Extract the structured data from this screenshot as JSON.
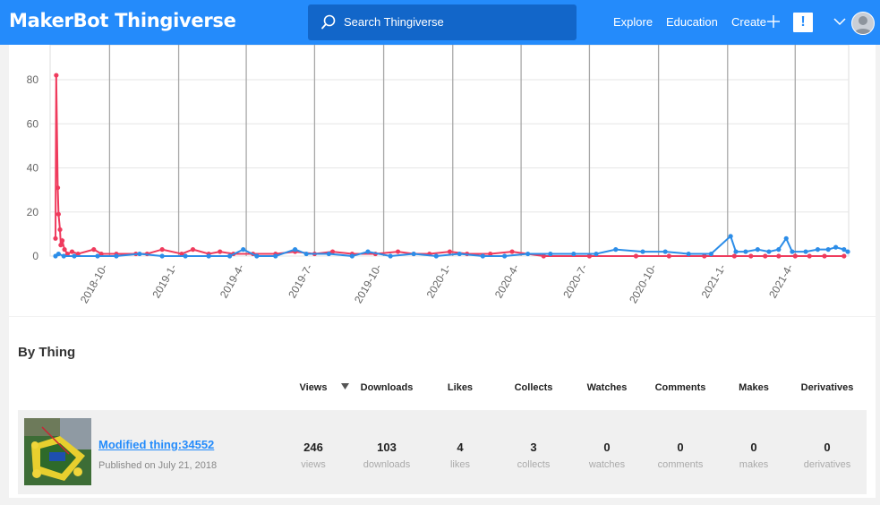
{
  "header": {
    "logo_brand": "MakerBot",
    "logo_product": "Thingiverse",
    "search_placeholder": "Search Thingiverse",
    "nav": {
      "explore": "Explore",
      "education": "Education",
      "create": "Create"
    },
    "alert_label": "!",
    "colors": {
      "bar": "#248bfb",
      "search": "#1266c9"
    }
  },
  "chart_data": {
    "type": "line",
    "y_ticks": [
      "0",
      "20",
      "40",
      "60",
      "80"
    ],
    "ylim": [
      0,
      90
    ],
    "x_ticks": [
      "2018-10-",
      "2019-1-",
      "2019-4-",
      "2019-7-",
      "2019-10-",
      "2020-1-",
      "2020-4-",
      "2020-7-",
      "2020-10-",
      "2021-1-",
      "2021-4-"
    ],
    "grid": true,
    "x_range": [
      "2018-07-21",
      "2021-06-10"
    ],
    "series": [
      {
        "color": "#ef3b5d",
        "points": [
          [
            "2018-07-21",
            8
          ],
          [
            "2018-07-22",
            82
          ],
          [
            "2018-07-24",
            31
          ],
          [
            "2018-07-25",
            19
          ],
          [
            "2018-07-27",
            12
          ],
          [
            "2018-07-28",
            5
          ],
          [
            "2018-07-30",
            7
          ],
          [
            "2018-08-02",
            3
          ],
          [
            "2018-08-06",
            1
          ],
          [
            "2018-08-12",
            2
          ],
          [
            "2018-08-20",
            1
          ],
          [
            "2018-09-10",
            3
          ],
          [
            "2018-09-20",
            1
          ],
          [
            "2018-10-10",
            1
          ],
          [
            "2018-11-05",
            1
          ],
          [
            "2018-11-20",
            1
          ],
          [
            "2018-12-10",
            3
          ],
          [
            "2019-01-05",
            1
          ],
          [
            "2019-01-20",
            3
          ],
          [
            "2019-02-10",
            1
          ],
          [
            "2019-02-25",
            2
          ],
          [
            "2019-03-15",
            1
          ],
          [
            "2019-04-10",
            1
          ],
          [
            "2019-05-10",
            1
          ],
          [
            "2019-06-05",
            2
          ],
          [
            "2019-07-01",
            1
          ],
          [
            "2019-07-25",
            2
          ],
          [
            "2019-08-20",
            1
          ],
          [
            "2019-09-20",
            1
          ],
          [
            "2019-10-20",
            2
          ],
          [
            "2019-11-10",
            1
          ],
          [
            "2019-12-01",
            1
          ],
          [
            "2019-12-28",
            2
          ],
          [
            "2020-01-20",
            1
          ],
          [
            "2020-02-20",
            1
          ],
          [
            "2020-03-20",
            2
          ],
          [
            "2020-05-01",
            0
          ],
          [
            "2020-07-01",
            0
          ],
          [
            "2020-09-01",
            0
          ],
          [
            "2020-10-15",
            0
          ],
          [
            "2020-12-01",
            0
          ],
          [
            "2021-01-10",
            0
          ],
          [
            "2021-02-01",
            0
          ],
          [
            "2021-02-20",
            0
          ],
          [
            "2021-03-10",
            0
          ],
          [
            "2021-04-01",
            0
          ],
          [
            "2021-04-20",
            0
          ],
          [
            "2021-05-10",
            0
          ],
          [
            "2021-06-05",
            0
          ]
        ]
      },
      {
        "color": "#2c8de8",
        "points": [
          [
            "2018-07-21",
            0
          ],
          [
            "2018-07-25",
            1
          ],
          [
            "2018-08-01",
            0
          ],
          [
            "2018-08-15",
            0
          ],
          [
            "2018-09-15",
            0
          ],
          [
            "2018-10-10",
            0
          ],
          [
            "2018-11-10",
            1
          ],
          [
            "2018-12-10",
            0
          ],
          [
            "2019-01-10",
            0
          ],
          [
            "2019-02-10",
            0
          ],
          [
            "2019-03-10",
            0
          ],
          [
            "2019-03-28",
            3
          ],
          [
            "2019-04-15",
            0
          ],
          [
            "2019-05-10",
            0
          ],
          [
            "2019-06-05",
            3
          ],
          [
            "2019-06-20",
            1
          ],
          [
            "2019-07-20",
            1
          ],
          [
            "2019-08-20",
            0
          ],
          [
            "2019-09-10",
            2
          ],
          [
            "2019-10-10",
            0
          ],
          [
            "2019-11-10",
            1
          ],
          [
            "2019-12-10",
            0
          ],
          [
            "2020-01-10",
            1
          ],
          [
            "2020-02-10",
            0
          ],
          [
            "2020-03-10",
            0
          ],
          [
            "2020-04-10",
            1
          ],
          [
            "2020-05-10",
            1
          ],
          [
            "2020-06-10",
            1
          ],
          [
            "2020-07-10",
            1
          ],
          [
            "2020-08-05",
            3
          ],
          [
            "2020-09-10",
            2
          ],
          [
            "2020-10-10",
            2
          ],
          [
            "2020-11-10",
            1
          ],
          [
            "2020-12-10",
            1
          ],
          [
            "2021-01-05",
            9
          ],
          [
            "2021-01-12",
            2
          ],
          [
            "2021-01-25",
            2
          ],
          [
            "2021-02-10",
            3
          ],
          [
            "2021-02-25",
            2
          ],
          [
            "2021-03-10",
            3
          ],
          [
            "2021-03-20",
            8
          ],
          [
            "2021-03-28",
            2
          ],
          [
            "2021-04-15",
            2
          ],
          [
            "2021-05-01",
            3
          ],
          [
            "2021-05-15",
            3
          ],
          [
            "2021-05-25",
            4
          ],
          [
            "2021-06-05",
            3
          ],
          [
            "2021-06-10",
            2
          ]
        ]
      }
    ]
  },
  "by_thing": {
    "title": "By Thing",
    "columns": [
      "Views",
      "Downloads",
      "Likes",
      "Collects",
      "Watches",
      "Comments",
      "Makes",
      "Derivatives"
    ],
    "row": {
      "name": "Modified thing:34552",
      "published": "Published on July 21, 2018",
      "stats": [
        {
          "value": "246",
          "label": "views"
        },
        {
          "value": "103",
          "label": "downloads"
        },
        {
          "value": "4",
          "label": "likes"
        },
        {
          "value": "3",
          "label": "collects"
        },
        {
          "value": "0",
          "label": "watches"
        },
        {
          "value": "0",
          "label": "comments"
        },
        {
          "value": "0",
          "label": "makes"
        },
        {
          "value": "0",
          "label": "derivatives"
        }
      ]
    }
  }
}
